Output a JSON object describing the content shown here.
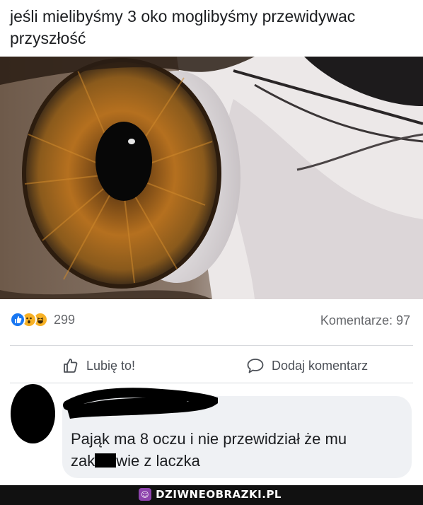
{
  "post": {
    "text": "jeśli mielibyśmy 3 oko moglibyśmy przewidywac przyszłość"
  },
  "stats": {
    "reactions": [
      "like-icon",
      "wow-icon",
      "haha-icon"
    ],
    "reaction_count": "299",
    "comments_label": "Komentarze: 97"
  },
  "actions": {
    "like_label": "Lubię to!",
    "comment_label": "Dodaj komentarz"
  },
  "comment": {
    "line1": "Pająk ma 8 oczu i nie przewidział że mu",
    "line2_before": "zak",
    "line2_after": "wie z laczka"
  },
  "footer": {
    "brand": "DZIWNEOBRAZKI.PL"
  },
  "colors": {
    "like_blue": "#1877f2",
    "reaction_yellow": "#f7b125",
    "bubble_bg": "#eff1f4",
    "footer_bg": "#111111",
    "brand_badge": "#8e44ad"
  }
}
